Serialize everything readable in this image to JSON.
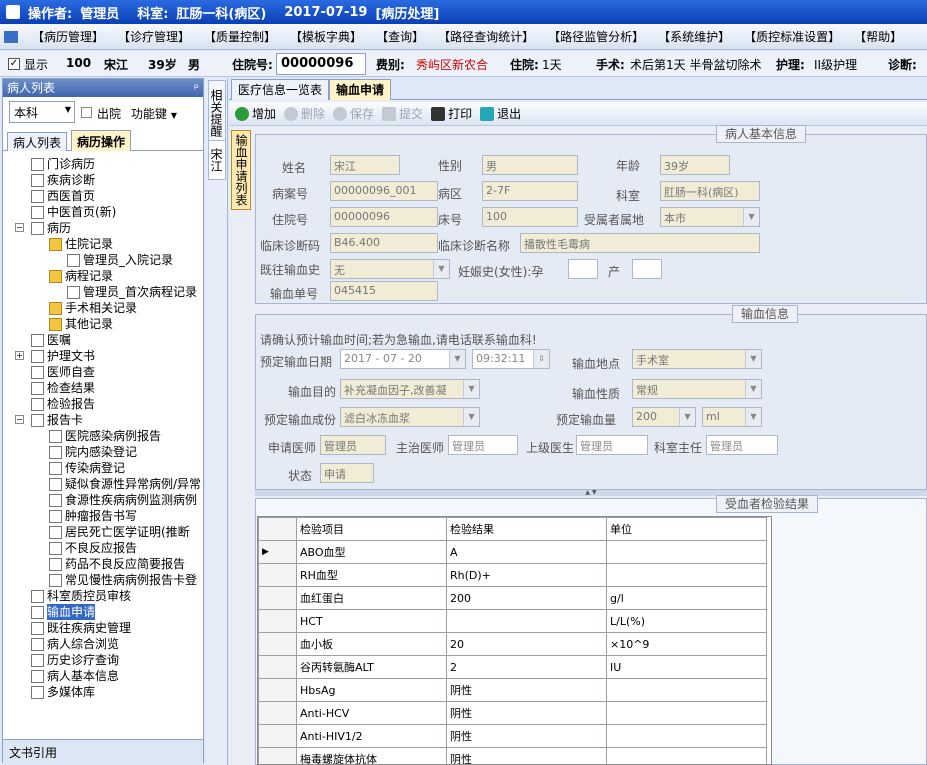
{
  "titlebar": {
    "label_operator": "操作者:",
    "operator": "管理员",
    "label_dept": "科室:",
    "dept": "肛肠一科(病区)",
    "date": "2017-07-19",
    "module": "[病历处理]"
  },
  "menu": [
    "【病历管理】",
    "【诊疗管理】",
    "【质量控制】",
    "【模板字典】",
    "【查询】",
    "【路径查询统计】",
    "【路径监管分析】",
    "【系统维护】",
    "【质控标准设置】",
    "【帮助】"
  ],
  "patient_bar": {
    "show_label": "显示",
    "bed": "100",
    "name": "宋江",
    "age": "39岁",
    "sex": "男",
    "inpatient_label": "住院号:",
    "inpatient_no": "00000096",
    "fee_label": "费别:",
    "fee_type": "秀屿区新农合",
    "days_label": "住院:",
    "days": "1天",
    "surgery_label": "手术:",
    "surgery": "术后第1天 半骨盆切除术",
    "nursing_label": "护理:",
    "nursing": "II级护理",
    "diag_label": "诊断:"
  },
  "left": {
    "header": "病人列表",
    "dept_select": "本科",
    "discharge": "出院",
    "func_key": "功能键",
    "tabs": [
      "病人列表",
      "病历操作"
    ],
    "footer": "文书引用"
  },
  "tree": [
    {
      "t": "门诊病历",
      "d": 1,
      "i": "doc"
    },
    {
      "t": "疾病诊断",
      "d": 1,
      "i": "doc"
    },
    {
      "t": "西医首页",
      "d": 1,
      "i": "doc"
    },
    {
      "t": "中医首页(新)",
      "d": 1,
      "i": "doc"
    },
    {
      "t": "病历",
      "d": 1,
      "i": "doc"
    },
    {
      "t": "住院记录",
      "d": 2,
      "i": "folder"
    },
    {
      "t": "管理员_入院记录",
      "d": 3,
      "i": "doc"
    },
    {
      "t": "病程记录",
      "d": 2,
      "i": "folder"
    },
    {
      "t": "管理员_首次病程记录",
      "d": 3,
      "i": "doc"
    },
    {
      "t": "手术相关记录",
      "d": 2,
      "i": "folder"
    },
    {
      "t": "其他记录",
      "d": 2,
      "i": "folder"
    },
    {
      "t": "医嘱",
      "d": 1,
      "i": "doc"
    },
    {
      "t": "护理文书",
      "d": 1,
      "i": "doc"
    },
    {
      "t": "医师自查",
      "d": 1,
      "i": "doc"
    },
    {
      "t": "检查结果",
      "d": 1,
      "i": "doc"
    },
    {
      "t": "检验报告",
      "d": 1,
      "i": "doc"
    },
    {
      "t": "报告卡",
      "d": 1,
      "i": "doc"
    },
    {
      "t": "医院感染病例报告",
      "d": 2,
      "i": "doc"
    },
    {
      "t": "院内感染登记",
      "d": 2,
      "i": "doc"
    },
    {
      "t": "传染病登记",
      "d": 2,
      "i": "doc"
    },
    {
      "t": "疑似食源性异常病例/异常",
      "d": 2,
      "i": "doc"
    },
    {
      "t": "食源性疾病病例监测病例",
      "d": 2,
      "i": "doc"
    },
    {
      "t": "肿瘤报告书写",
      "d": 2,
      "i": "doc"
    },
    {
      "t": "居民死亡医学证明(推断",
      "d": 2,
      "i": "doc"
    },
    {
      "t": "不良反应报告",
      "d": 2,
      "i": "doc"
    },
    {
      "t": "药品不良反应简要报告",
      "d": 2,
      "i": "doc"
    },
    {
      "t": "常见慢性病病例报告卡登",
      "d": 2,
      "i": "doc"
    },
    {
      "t": "科室质控员审核",
      "d": 1,
      "i": "doc"
    },
    {
      "t": "输血申请",
      "d": 1,
      "i": "doc",
      "sel": true
    },
    {
      "t": "既往疾病史管理",
      "d": 1,
      "i": "doc"
    },
    {
      "t": "病人综合浏览",
      "d": 1,
      "i": "doc"
    },
    {
      "t": "历史诊疗查询",
      "d": 1,
      "i": "doc"
    },
    {
      "t": "病人基本信息",
      "d": 1,
      "i": "doc"
    },
    {
      "t": "多媒体库",
      "d": 1,
      "i": "doc"
    }
  ],
  "vtabs": [
    "相关提醒",
    "宋江"
  ],
  "top_tabs": [
    "医疗信息一览表",
    "输血申请"
  ],
  "toolbar": {
    "add": "增加",
    "del": "删除",
    "save": "保存",
    "submit": "提交",
    "print": "打印",
    "exit": "退出"
  },
  "side_tab": "输血申请列表",
  "basic": {
    "title": "病人基本信息",
    "name_l": "姓名",
    "name": "宋江",
    "sex_l": "性别",
    "sex": "男",
    "age_l": "年龄",
    "age": "39岁",
    "case_l": "病案号",
    "case_no": "00000096_001",
    "ward_l": "病区",
    "ward": "2-7F",
    "dept_l": "科室",
    "dept": "肛肠一科(病区)",
    "inp_l": "住院号",
    "inp": "00000096",
    "bed_l": "床号",
    "bed": "100",
    "region_l": "受属者属地",
    "region": "本市",
    "dcode_l": "临床诊断码",
    "dcode": "B46.400",
    "dname_l": "临床诊断名称",
    "dname": "播散性毛霉病",
    "hist_l": "既往输血史",
    "hist": "无",
    "preg_l": "妊娠史(女性):孕",
    "birth_l": "产",
    "order_l": "输血单号",
    "order": "045415"
  },
  "trans": {
    "title": "输血信息",
    "notice": "请确认预计输血时间;若为急输血,请电话联系输血科!",
    "date_l": "预定输血日期",
    "date": "2017 - 07 - 20",
    "time": "09:32:11",
    "place_l": "输血地点",
    "place": "手术室",
    "purpose_l": "输血目的",
    "purpose": "补充凝血因子,改善凝",
    "nature_l": "输血性质",
    "nature": "常规",
    "comp_l": "预定输血成份",
    "comp": "滤白冰冻血浆",
    "amount_l": "预定输血量",
    "amount": "200",
    "unit": "ml",
    "req_l": "申请医师",
    "req": "管理员",
    "main_l": "主治医师",
    "main": "管理员",
    "sup_l": "上级医生",
    "sup": "管理员",
    "chief_l": "科室主任",
    "chief": "管理员",
    "status_l": "状态",
    "status": "申请"
  },
  "lab": {
    "title": "受血者检验结果",
    "headers": [
      "检验项目",
      "检验结果",
      "单位"
    ],
    "rows": [
      [
        "ABO血型",
        "A",
        ""
      ],
      [
        "RH血型",
        "Rh(D)+",
        ""
      ],
      [
        "血红蛋白",
        "200",
        "g/l"
      ],
      [
        "HCT",
        "",
        "L/L(%)"
      ],
      [
        "血小板",
        "20",
        "×10^9"
      ],
      [
        "谷丙转氨酶ALT",
        "2",
        "IU"
      ],
      [
        "HbsAg",
        "阴性",
        ""
      ],
      [
        "Anti-HCV",
        "阴性",
        ""
      ],
      [
        "Anti-HIV1/2",
        "阴性",
        ""
      ],
      [
        "梅毒螺旋体抗体",
        "阴性",
        ""
      ]
    ]
  }
}
